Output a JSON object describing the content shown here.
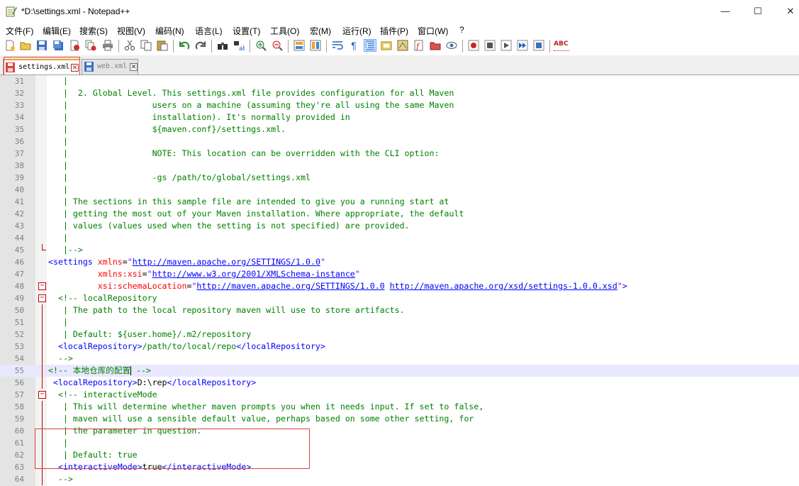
{
  "window": {
    "title": "*D:\\settings.xml - Notepad++",
    "min_glyph": "—",
    "max_glyph": "☐",
    "close_glyph": "✕"
  },
  "menu": [
    "文件(F)",
    "编辑(E)",
    "搜索(S)",
    "视图(V)",
    "编码(N)",
    "语言(L)",
    "设置(T)",
    "工具(O)",
    "宏(M)",
    "运行(R)",
    "插件(P)",
    "窗口(W)",
    "?"
  ],
  "toolbar_icons": [
    "new-icon",
    "open-icon",
    "save-icon",
    "save-all-icon",
    "close-icon",
    "close-all-icon",
    "print-icon",
    "cut-icon",
    "copy-icon",
    "paste-icon",
    "undo-icon",
    "redo-icon",
    "find-icon",
    "replace-icon",
    "zoom-in-icon",
    "zoom-out-icon",
    "sync-vertical-icon",
    "sync-horizontal-icon",
    "word-wrap-icon",
    "show-all-chars-icon",
    "indent-guide-icon",
    "user-language-icon",
    "doc-map-icon",
    "function-list-icon",
    "folder-workspace-icon",
    "monitoring-icon",
    "record-macro-icon",
    "stop-macro-icon",
    "play-macro-icon",
    "run-macro-multiple-icon",
    "save-macro-icon",
    "spell-check-icon"
  ],
  "spell_check_label": "ABC",
  "tabs": [
    {
      "label": "settings.xml",
      "close": "✕",
      "active": true
    },
    {
      "label": "web.xml",
      "close": "✕",
      "active": false
    }
  ],
  "colors": {
    "comment": "#008000",
    "tag": "#0000ff",
    "attribute": "#ff0000",
    "value": "#8000ff",
    "current_line": "#e8e8ff",
    "highlight_box": "#e04040"
  },
  "editor": {
    "current_line": 55,
    "lines": [
      {
        "n": "31",
        "segs": [
          {
            "k": "c",
            "t": "   |"
          }
        ]
      },
      {
        "n": "32",
        "segs": [
          {
            "k": "c",
            "t": "   |  2. Global Level. This settings.xml file provides configuration for all Maven"
          }
        ]
      },
      {
        "n": "33",
        "segs": [
          {
            "k": "c",
            "t": "   |                 users on a machine (assuming they're all using the same Maven"
          }
        ]
      },
      {
        "n": "34",
        "segs": [
          {
            "k": "c",
            "t": "   |                 installation). It's normally provided in"
          }
        ]
      },
      {
        "n": "35",
        "segs": [
          {
            "k": "c",
            "t": "   |                 ${maven.conf}/settings.xml."
          }
        ]
      },
      {
        "n": "36",
        "segs": [
          {
            "k": "c",
            "t": "   |"
          }
        ]
      },
      {
        "n": "37",
        "segs": [
          {
            "k": "c",
            "t": "   |                 NOTE: This location can be overridden with the CLI option:"
          }
        ]
      },
      {
        "n": "38",
        "segs": [
          {
            "k": "c",
            "t": "   |"
          }
        ]
      },
      {
        "n": "39",
        "segs": [
          {
            "k": "c",
            "t": "   |                 -gs /path/to/global/settings.xml"
          }
        ]
      },
      {
        "n": "40",
        "segs": [
          {
            "k": "c",
            "t": "   |"
          }
        ]
      },
      {
        "n": "41",
        "segs": [
          {
            "k": "c",
            "t": "   | The sections in this sample file are intended to give you a running start at"
          }
        ]
      },
      {
        "n": "42",
        "segs": [
          {
            "k": "c",
            "t": "   | getting the most out of your Maven installation. Where appropriate, the default"
          }
        ]
      },
      {
        "n": "43",
        "segs": [
          {
            "k": "c",
            "t": "   | values (values used when the setting is not specified) are provided."
          }
        ]
      },
      {
        "n": "44",
        "segs": [
          {
            "k": "c",
            "t": "   |"
          }
        ]
      },
      {
        "n": "45",
        "segs": [
          {
            "k": "c",
            "t": "   |-->"
          }
        ]
      },
      {
        "n": "46",
        "segs": [
          {
            "k": "t",
            "t": "<settings"
          },
          {
            "k": "p",
            "t": " "
          },
          {
            "k": "a",
            "t": "xmlns"
          },
          {
            "k": "p",
            "t": "="
          },
          {
            "k": "q",
            "t": "\""
          },
          {
            "k": "u",
            "t": "http://maven.apache.org/SETTINGS/1.0.0"
          },
          {
            "k": "q",
            "t": "\""
          }
        ]
      },
      {
        "n": "47",
        "segs": [
          {
            "k": "p",
            "t": "          "
          },
          {
            "k": "a",
            "t": "xmlns:xsi"
          },
          {
            "k": "p",
            "t": "="
          },
          {
            "k": "q",
            "t": "\""
          },
          {
            "k": "u",
            "t": "http://www.w3.org/2001/XMLSchema-instance"
          },
          {
            "k": "q",
            "t": "\""
          }
        ]
      },
      {
        "n": "48",
        "segs": [
          {
            "k": "p",
            "t": "          "
          },
          {
            "k": "a",
            "t": "xsi:schemaLocation"
          },
          {
            "k": "p",
            "t": "="
          },
          {
            "k": "q",
            "t": "\""
          },
          {
            "k": "u",
            "t": "http://maven.apache.org/SETTINGS/1.0.0"
          },
          {
            "k": "p",
            "t": " "
          },
          {
            "k": "u",
            "t": "http://maven.apache.org/xsd/settings-1.0.0.xsd"
          },
          {
            "k": "q",
            "t": "\""
          },
          {
            "k": "t",
            "t": ">"
          }
        ]
      },
      {
        "n": "49",
        "segs": [
          {
            "k": "c",
            "t": "  <!-- localRepository"
          }
        ]
      },
      {
        "n": "50",
        "segs": [
          {
            "k": "c",
            "t": "   | The path to the local repository maven will use to store artifacts."
          }
        ]
      },
      {
        "n": "51",
        "segs": [
          {
            "k": "c",
            "t": "   |"
          }
        ]
      },
      {
        "n": "52",
        "segs": [
          {
            "k": "c",
            "t": "   | Default: ${user.home}/.m2/repository"
          }
        ]
      },
      {
        "n": "53",
        "segs": [
          {
            "k": "t",
            "t": "  <localRepository>"
          },
          {
            "k": "c",
            "t": "/path/to/local/repo"
          },
          {
            "k": "t",
            "t": "</localRepository>"
          }
        ]
      },
      {
        "n": "54",
        "segs": [
          {
            "k": "c",
            "t": "  -->"
          }
        ]
      },
      {
        "n": "55",
        "segs": [
          {
            "k": "c",
            "t": "<!-- 本地仓库的配置"
          },
          {
            "k": "cursor",
            "t": ""
          },
          {
            "k": "c",
            "t": " -->"
          }
        ]
      },
      {
        "n": "56",
        "segs": [
          {
            "k": "t",
            "t": " <localRepository>"
          },
          {
            "k": "p",
            "t": "D:\\rep"
          },
          {
            "k": "t",
            "t": "</localRepository>"
          }
        ]
      },
      {
        "n": "57",
        "segs": [
          {
            "k": "c",
            "t": "  <!-- interactiveMode"
          }
        ]
      },
      {
        "n": "58",
        "segs": [
          {
            "k": "c",
            "t": "   | This will determine whether maven prompts you when it needs input. If set to false,"
          }
        ]
      },
      {
        "n": "59",
        "segs": [
          {
            "k": "c",
            "t": "   | maven will use a sensible default value, perhaps based on some other setting, for"
          }
        ]
      },
      {
        "n": "60",
        "segs": [
          {
            "k": "c",
            "t": "   | the parameter in question."
          }
        ]
      },
      {
        "n": "61",
        "segs": [
          {
            "k": "c",
            "t": "   |"
          }
        ]
      },
      {
        "n": "62",
        "segs": [
          {
            "k": "c",
            "t": "   | Default: true"
          }
        ]
      },
      {
        "n": "63",
        "segs": [
          {
            "k": "t",
            "t": "  <interactiveMode>"
          },
          {
            "k": "p",
            "t": "true"
          },
          {
            "k": "t",
            "t": "</interactiveMode>"
          }
        ]
      },
      {
        "n": "64",
        "segs": [
          {
            "k": "c",
            "t": "  -->"
          }
        ]
      }
    ]
  }
}
